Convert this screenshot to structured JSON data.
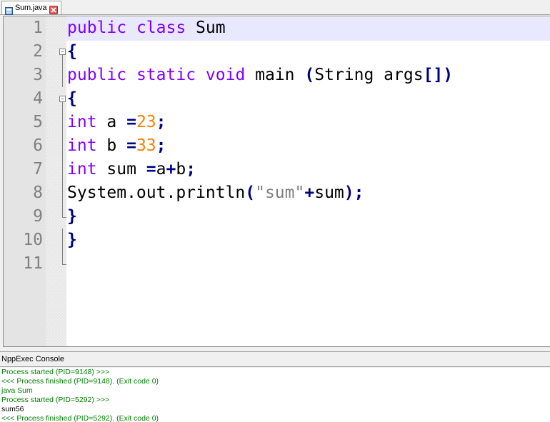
{
  "tab": {
    "label": "Sum.java",
    "icon": "java-file-icon",
    "close_icon": "close-icon"
  },
  "editor": {
    "lines": [
      {
        "num": "1",
        "fold": "",
        "tokens": [
          {
            "t": "public",
            "c": "kw"
          },
          {
            "t": " ",
            "c": "plain"
          },
          {
            "t": "class",
            "c": "kw"
          },
          {
            "t": " Sum",
            "c": "plain"
          }
        ]
      },
      {
        "num": "2",
        "fold": "open",
        "tokens": [
          {
            "t": "{",
            "c": "op"
          }
        ]
      },
      {
        "num": "3",
        "fold": "line",
        "tokens": [
          {
            "t": "public",
            "c": "kw"
          },
          {
            "t": " ",
            "c": "plain"
          },
          {
            "t": "static",
            "c": "kw"
          },
          {
            "t": " ",
            "c": "plain"
          },
          {
            "t": "void",
            "c": "kw"
          },
          {
            "t": " main ",
            "c": "plain"
          },
          {
            "t": "(",
            "c": "op"
          },
          {
            "t": "String args",
            "c": "plain"
          },
          {
            "t": "[])",
            "c": "op"
          }
        ]
      },
      {
        "num": "4",
        "fold": "open",
        "tokens": [
          {
            "t": "{",
            "c": "op"
          }
        ]
      },
      {
        "num": "5",
        "fold": "line",
        "tokens": [
          {
            "t": "int",
            "c": "typ"
          },
          {
            "t": " a ",
            "c": "plain"
          },
          {
            "t": "=",
            "c": "op"
          },
          {
            "t": "23",
            "c": "num"
          },
          {
            "t": ";",
            "c": "op"
          }
        ]
      },
      {
        "num": "6",
        "fold": "line",
        "tokens": [
          {
            "t": "int",
            "c": "typ"
          },
          {
            "t": " b ",
            "c": "plain"
          },
          {
            "t": "=",
            "c": "op"
          },
          {
            "t": "33",
            "c": "num"
          },
          {
            "t": ";",
            "c": "op"
          }
        ]
      },
      {
        "num": "7",
        "fold": "line",
        "tokens": [
          {
            "t": "int",
            "c": "typ"
          },
          {
            "t": " sum ",
            "c": "plain"
          },
          {
            "t": "=",
            "c": "op"
          },
          {
            "t": "a",
            "c": "plain"
          },
          {
            "t": "+",
            "c": "op"
          },
          {
            "t": "b",
            "c": "plain"
          },
          {
            "t": ";",
            "c": "op"
          }
        ]
      },
      {
        "num": "8",
        "fold": "line",
        "tokens": [
          {
            "t": "System.out.println",
            "c": "plain"
          },
          {
            "t": "(",
            "c": "op"
          },
          {
            "t": "\"sum\"",
            "c": "str"
          },
          {
            "t": "+",
            "c": "op"
          },
          {
            "t": "sum",
            "c": "plain"
          },
          {
            "t": ");",
            "c": "op"
          }
        ]
      },
      {
        "num": "9",
        "fold": "end",
        "tokens": [
          {
            "t": "}",
            "c": "op"
          }
        ]
      },
      {
        "num": "10",
        "fold": "line",
        "tokens": [
          {
            "t": "}",
            "c": "op"
          }
        ]
      },
      {
        "num": "11",
        "fold": "end",
        "tokens": []
      }
    ]
  },
  "console": {
    "title": "NppExec Console",
    "lines": [
      {
        "text": "Process started (PID=9148) >>>",
        "color": "green"
      },
      {
        "text": "<<< Process finished (PID=9148). (Exit code 0)",
        "color": "green"
      },
      {
        "text": "java Sum",
        "color": "green"
      },
      {
        "text": "Process started (PID=5292) >>>",
        "color": "green"
      },
      {
        "text": "sum56",
        "color": "black"
      },
      {
        "text": "<<< Process finished (PID=5292). (Exit code 0)",
        "color": "green"
      }
    ]
  },
  "colors": {
    "keyword": "#8000ff",
    "number": "#ff8000",
    "operator": "#000080",
    "string": "#808080",
    "console_green": "#008000",
    "current_line": "#e8e8ff"
  }
}
